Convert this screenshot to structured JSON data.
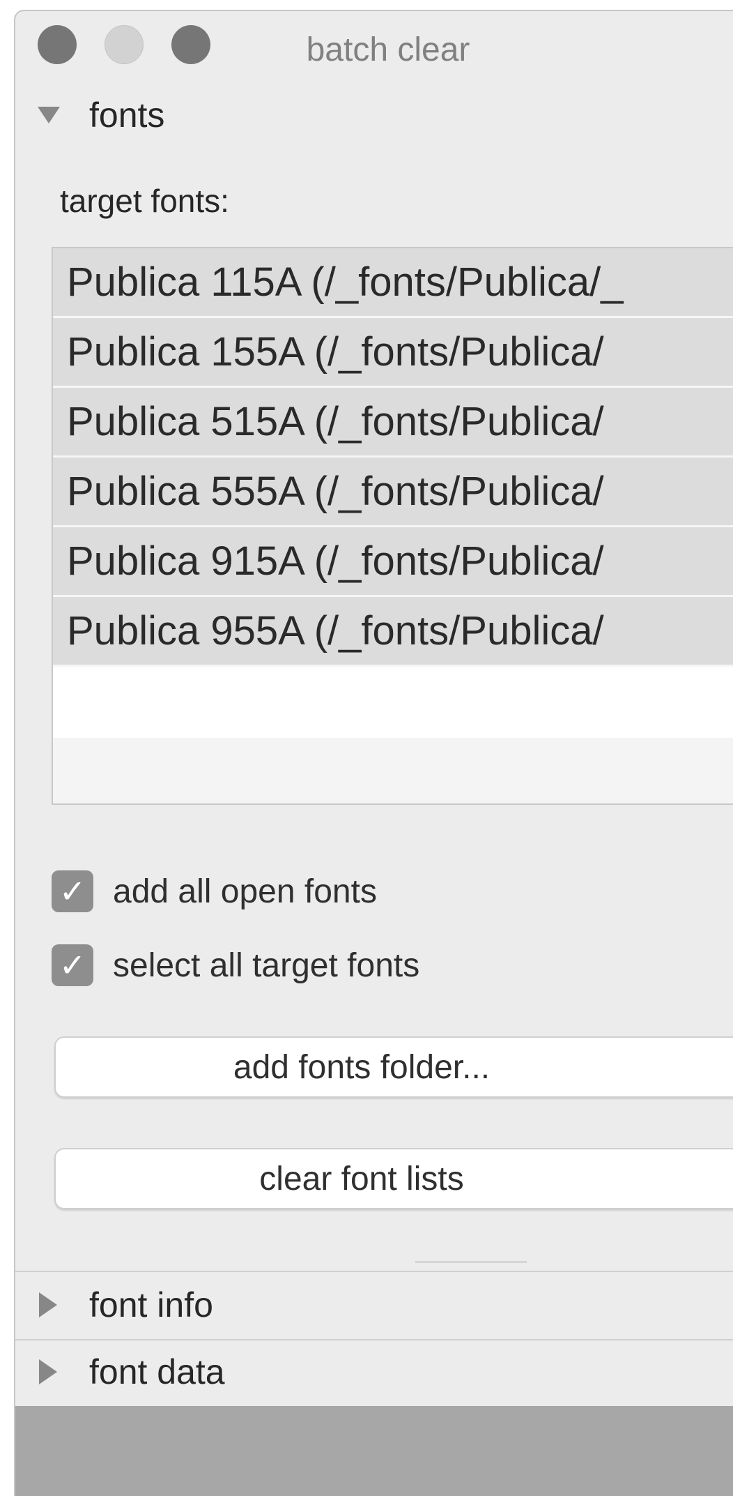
{
  "window": {
    "title": "batch clear"
  },
  "sections": {
    "fonts": {
      "label": "fonts",
      "expanded": true
    },
    "font_info": {
      "label": "font info",
      "expanded": false
    },
    "font_data": {
      "label": "font data",
      "expanded": false
    }
  },
  "fonts_panel": {
    "target_label": "target fonts:",
    "target_fonts": [
      "Publica 115A (/_fonts/Publica/_",
      "Publica 155A (/_fonts/Publica/",
      "Publica 515A (/_fonts/Publica/",
      "Publica 555A (/_fonts/Publica/",
      "Publica 915A (/_fonts/Publica/",
      "Publica 955A (/_fonts/Publica/"
    ],
    "checkboxes": [
      {
        "label": "add all open fonts",
        "checked": true
      },
      {
        "label": "select all target fonts",
        "checked": true
      }
    ],
    "buttons": {
      "add_folder": "add fonts folder...",
      "clear_lists": "clear font lists"
    }
  },
  "icons": {
    "check": "✓",
    "expanded": "disclosure-triangle-down",
    "collapsed": "disclosure-triangle-right"
  },
  "colors": {
    "window_bg": "#ececec",
    "selected_row": "#dcdcdc",
    "checkbox": "#8e8e8e",
    "footer": "#a7a7a7"
  }
}
